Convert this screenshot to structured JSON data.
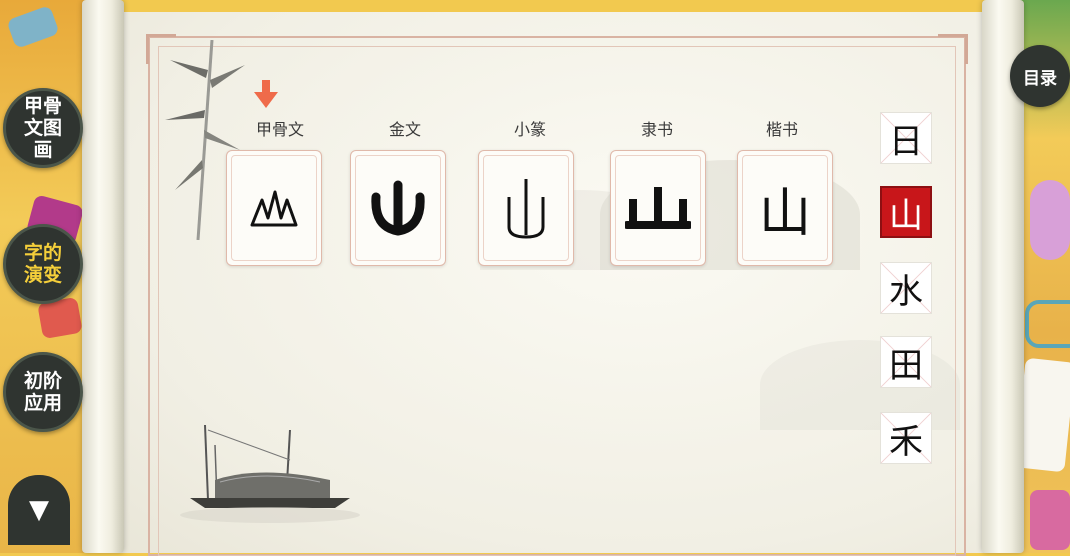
{
  "nav": {
    "items": [
      {
        "label": "甲骨文图画",
        "active": false
      },
      {
        "label": "字的演变",
        "active": true
      },
      {
        "label": "初阶应用",
        "active": false
      }
    ],
    "down_icon": "▼",
    "toc_label": "目录"
  },
  "scripts": {
    "labels": [
      "甲骨文",
      "金文",
      "小篆",
      "隶书",
      "楷书"
    ],
    "kaishu_glyph": "山"
  },
  "characters": {
    "items": [
      "日",
      "山",
      "水",
      "田",
      "禾"
    ],
    "selected": "山"
  },
  "colors": {
    "accent_red": "#c8161a",
    "arrow": "#ef6b4a",
    "nav_bg": "#2f3430",
    "nav_active_text": "#f5cf3a"
  }
}
